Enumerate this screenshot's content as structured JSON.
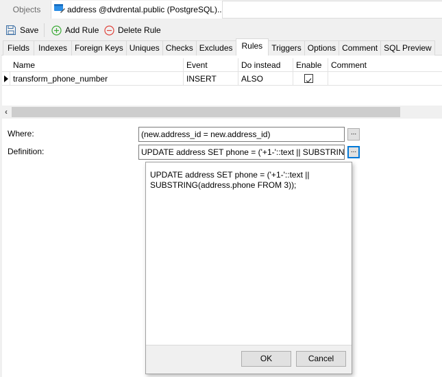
{
  "doc_tabs": {
    "objects_label": "Objects",
    "active_label": "address @dvdrental.public (PostgreSQL)...",
    "active_icon": "table-design-icon"
  },
  "toolbar": {
    "save_label": "Save",
    "save_icon": "save-icon",
    "add_rule_label": "Add Rule",
    "add_rule_icon": "plus-circle-icon",
    "delete_rule_label": "Delete Rule",
    "delete_rule_icon": "minus-circle-icon",
    "add_color": "#3aaa35",
    "delete_color": "#e0443c"
  },
  "prop_tabs": [
    {
      "label": "Fields",
      "active": false
    },
    {
      "label": "Indexes",
      "active": false
    },
    {
      "label": "Foreign Keys",
      "active": false
    },
    {
      "label": "Uniques",
      "active": false
    },
    {
      "label": "Checks",
      "active": false
    },
    {
      "label": "Excludes",
      "active": false
    },
    {
      "label": "Rules",
      "active": true
    },
    {
      "label": "Triggers",
      "active": false
    },
    {
      "label": "Options",
      "active": false
    },
    {
      "label": "Comment",
      "active": false
    },
    {
      "label": "SQL Preview",
      "active": false
    }
  ],
  "grid": {
    "columns": [
      "Name",
      "Event",
      "Do instead",
      "Enable",
      "Comment"
    ],
    "rows": [
      {
        "name": "transform_phone_number",
        "event": "INSERT",
        "do_instead": "ALSO",
        "enable": true,
        "comment": ""
      }
    ]
  },
  "form": {
    "where_label": "Where:",
    "where_value": "(new.address_id = new.address_id)",
    "definition_label": "Definition:",
    "definition_value": "UPDATE address SET phone = ('+1-'::text || SUBSTRING(address.phone FROM 3));",
    "ellipsis_label": "..."
  },
  "popup": {
    "text": "UPDATE address SET phone = ('+1-'::text || SUBSTRING(address.phone FROM 3));",
    "ok_label": "OK",
    "cancel_label": "Cancel"
  }
}
